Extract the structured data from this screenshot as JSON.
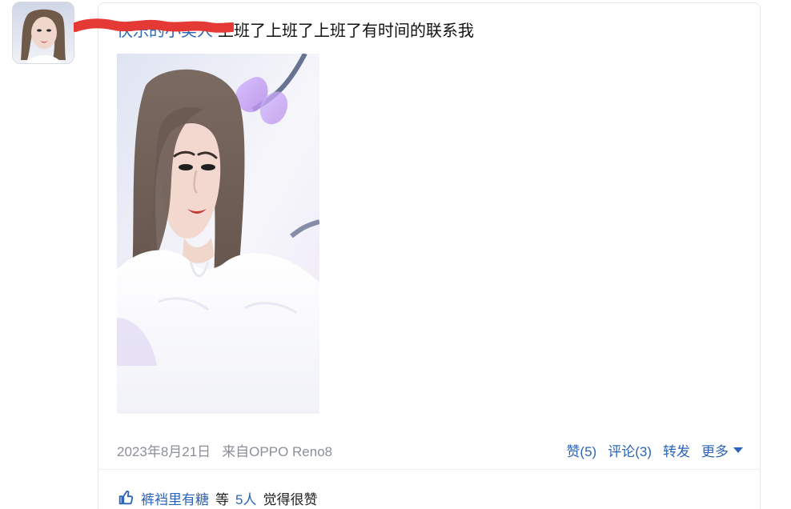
{
  "post": {
    "author_name": "快乐的小美人",
    "text": "上班了上班了上班了有时间的联系我",
    "date": "2023年8月21日",
    "source": "来自OPPO Reno8",
    "actions": {
      "like": "赞(5)",
      "comment": "评论(3)",
      "forward": "转发",
      "more": "更多"
    }
  },
  "likes": {
    "user": "裤裆里有糖",
    "prefix": "等",
    "count": "5人",
    "suffix": "觉得很赞"
  },
  "colors": {
    "link": "#2c64b8",
    "meta": "#8a8f99",
    "redaction": "#e53935"
  },
  "icons": {
    "thumb": "thumbs-up-icon",
    "caret": "caret-down-icon"
  }
}
